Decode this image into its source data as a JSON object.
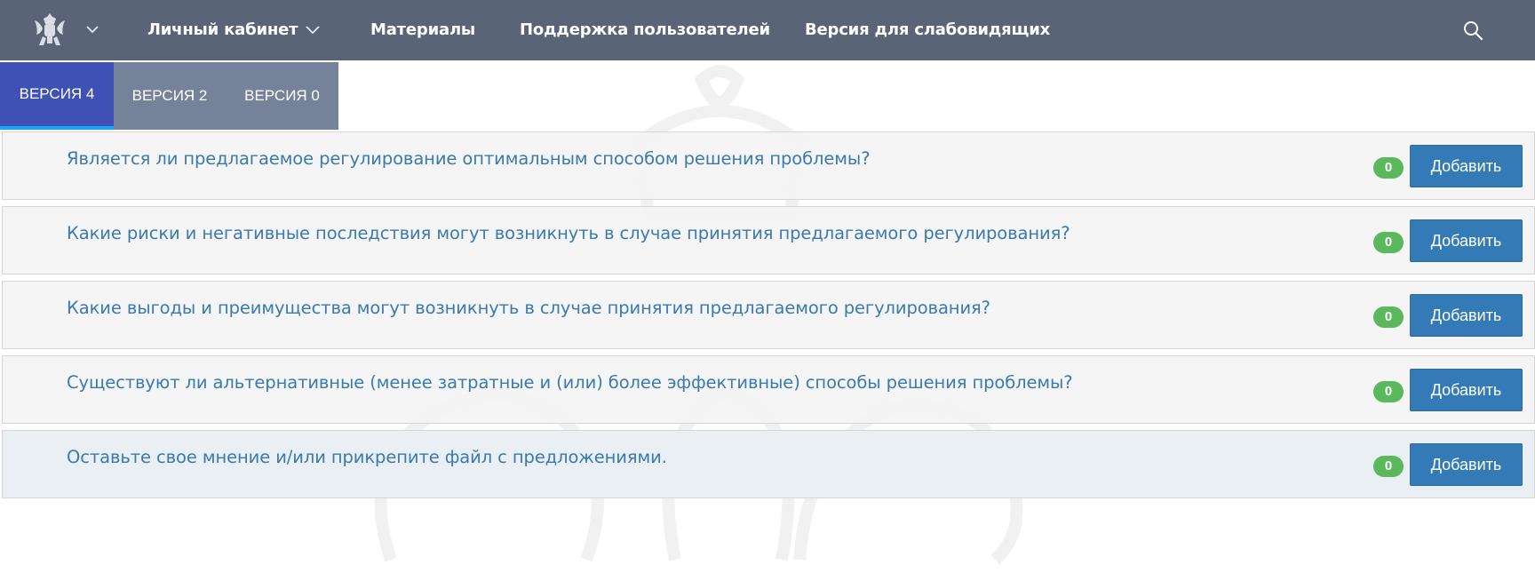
{
  "header": {
    "logo_icon": "coat-of-arms-icon",
    "nav": [
      {
        "label": "Личный кабинет",
        "has_dropdown": true
      },
      {
        "label": "Материалы"
      },
      {
        "label": "Поддержка пользователей"
      },
      {
        "label": "Версия для слабовидящих"
      }
    ],
    "search_icon": "search-icon",
    "bg_color": "#5a6477"
  },
  "tabs": [
    {
      "label": "ВЕРСИЯ 4",
      "active": true
    },
    {
      "label": "ВЕРСИЯ 2",
      "active": false
    },
    {
      "label": "ВЕРСИЯ 0",
      "active": false
    }
  ],
  "questions": [
    {
      "text": "Является ли предлагаемое регулирование оптимальным способом решения проблемы?",
      "count": "0",
      "button": "Добавить"
    },
    {
      "text": "Какие риски и негативные последствия могут возникнуть в случае принятия предлагаемого регулирования?",
      "count": "0",
      "button": "Добавить"
    },
    {
      "text": "Какие выгоды и преимущества могут возникнуть в случае принятия предлагаемого регулирования?",
      "count": "0",
      "button": "Добавить"
    },
    {
      "text": "Существуют ли альтернативные (менее затратные и (или) более эффективные) способы решения проблемы?",
      "count": "0",
      "button": "Добавить"
    },
    {
      "text": "Оставьте свое мнение и/или прикрепите файл с предложениями.",
      "count": "0",
      "button": "Добавить"
    }
  ],
  "colors": {
    "accent": "#3f51b5",
    "button": "#337ab7",
    "badge": "#5cb85c",
    "link_text": "#3a7ab0"
  }
}
